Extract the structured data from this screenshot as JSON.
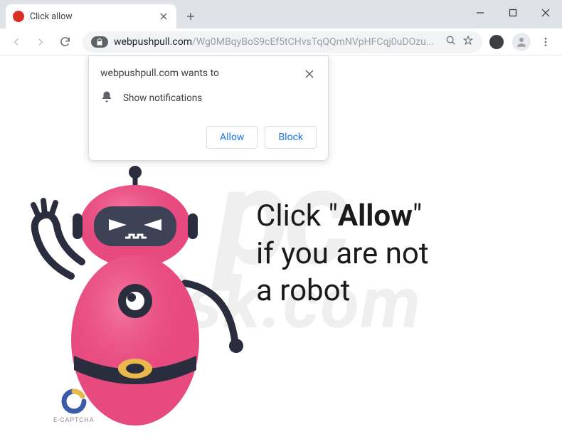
{
  "window": {
    "tab_title": "Click allow"
  },
  "url": {
    "domain": "webpushpull.com",
    "path": "/Wg0MBqyBoS9cEf5tCHvsTqQQmNVpHFCqj0uDOzu..."
  },
  "permission": {
    "title": "webpushpull.com wants to",
    "body": "Show notifications",
    "allow": "Allow",
    "block": "Block"
  },
  "caption": {
    "pre": "Click \"",
    "emph": "Allow",
    "post1": "\"",
    "line2": "if you are not",
    "line3": "a robot"
  },
  "ecaptcha": {
    "label": "E-CAPTCHA"
  },
  "watermark": {
    "line1": "pc",
    "line2": "risk.com"
  },
  "colors": {
    "robot_body": "#e74a7f",
    "robot_dark": "#2a2d3e",
    "robot_visor": "#3d4257",
    "accent_blue": "#1a73e8"
  }
}
